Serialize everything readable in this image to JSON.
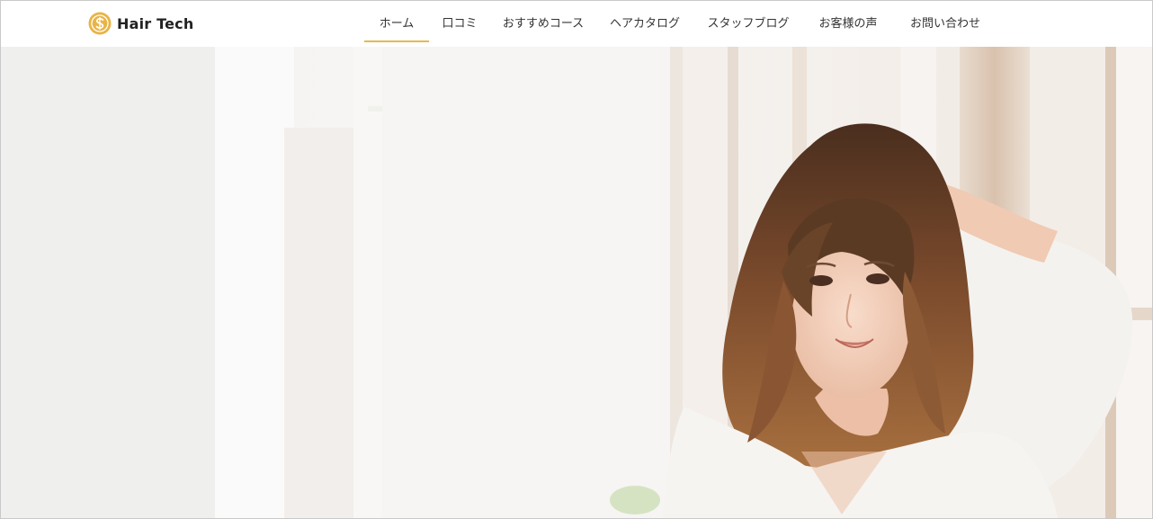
{
  "brand": {
    "name": "Hair Tech",
    "logo_icon": "dollar-coin-icon",
    "accent_color": "#e5b94d"
  },
  "nav": {
    "active_index": 0,
    "items": [
      {
        "label": "ホーム"
      },
      {
        "label": "口コミ"
      },
      {
        "label": "おすすめコース"
      },
      {
        "label": "ヘアカタログ"
      },
      {
        "label": "スタッフブログ"
      },
      {
        "label": "お客様の声"
      },
      {
        "label": "お問い合わせ"
      }
    ]
  },
  "hero": {
    "image": "hero-photo-woman"
  }
}
